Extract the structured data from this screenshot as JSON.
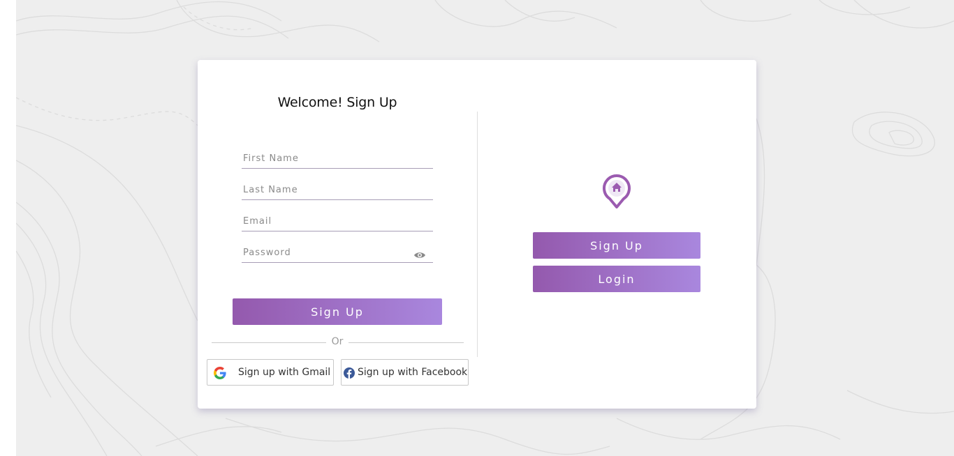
{
  "signup_form": {
    "title": "Welcome! Sign Up",
    "first_name_placeholder": "First Name",
    "first_name_value": "",
    "last_name_placeholder": "Last Name",
    "last_name_value": "",
    "email_placeholder": "Email",
    "email_value": "",
    "password_placeholder": "Password",
    "password_value": "",
    "password_toggle_icon": "eye-icon",
    "submit_label": "Sign Up",
    "or_label": "Or",
    "gmail_label": "Sign up with Gmail",
    "gmail_icon": "google-icon",
    "facebook_label": "Sign up with Facebook",
    "facebook_icon": "facebook-icon"
  },
  "side_panel": {
    "logo_icon": "home-pin-icon",
    "signup_label": "Sign Up",
    "login_label": "Login"
  },
  "colors": {
    "accent_start": "#9459ad",
    "accent_end": "#a987de",
    "background": "#eeeeee",
    "card": "#ffffff"
  }
}
